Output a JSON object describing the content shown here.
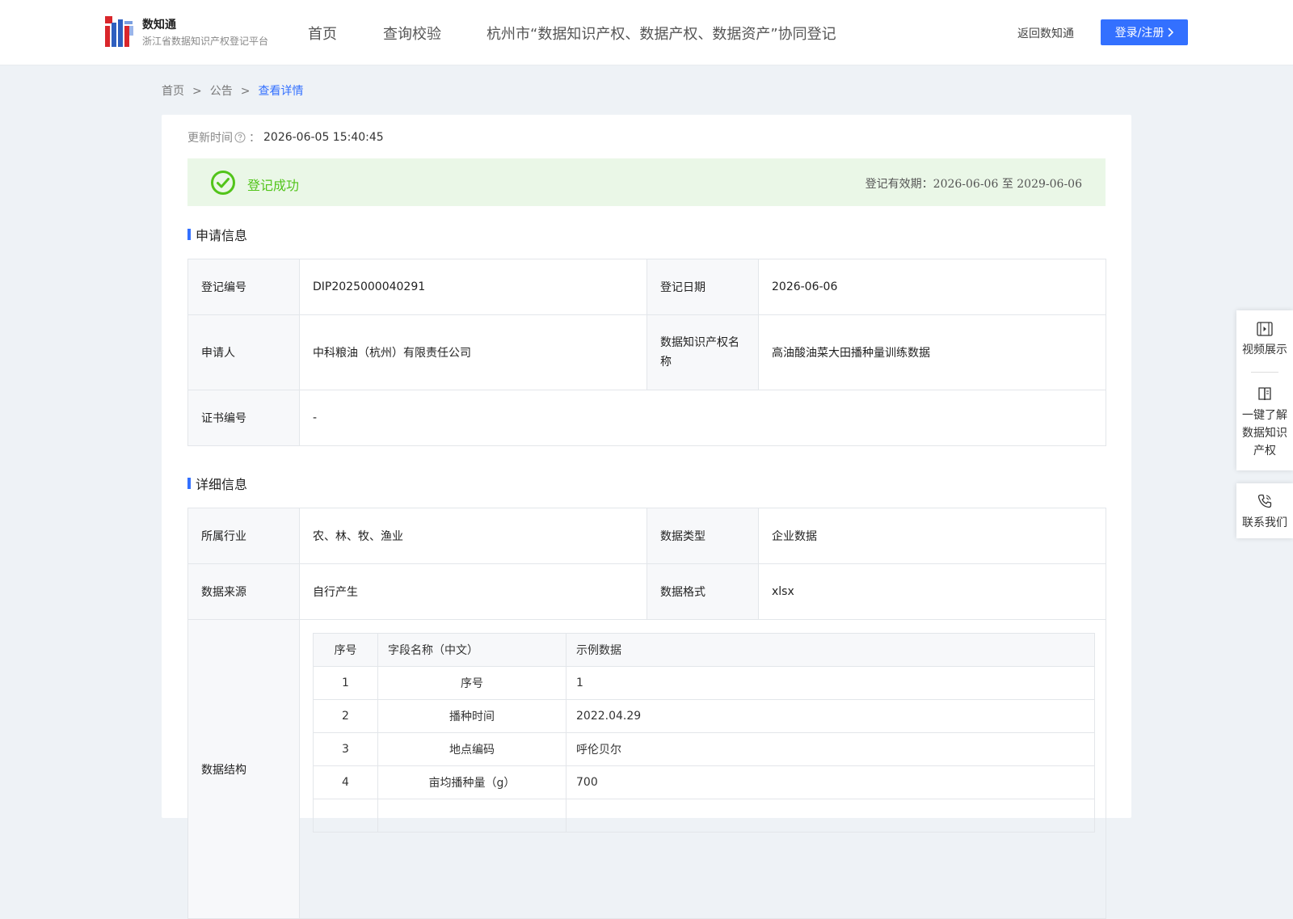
{
  "header": {
    "brand_name": "数知通",
    "brand_sub": "浙江省数据知识产权登记平台",
    "nav": [
      "首页",
      "查询校验",
      "杭州市“数据知识产权、数据产权、数据资产”协同登记"
    ],
    "back_link": "返回数知通",
    "login_label": "登录/注册"
  },
  "breadcrumb": [
    "首页",
    "公告",
    "查看详情"
  ],
  "update": {
    "label": "更新时间",
    "colon": "：",
    "time": "2026-06-05 15:40:45"
  },
  "status": {
    "text": "登记成功",
    "validity": "登记有效期：2026-06-06 至 2029-06-06",
    "color": "#52c41a"
  },
  "sections": {
    "apply": "申请信息",
    "detail": "详细信息"
  },
  "apply_info": {
    "reg_no_label": "登记编号",
    "reg_no": "DIP2025000040291",
    "reg_date_label": "登记日期",
    "reg_date": "2026-06-06",
    "applicant_label": "申请人",
    "applicant": "中科粮油（杭州）有限责任公司",
    "ip_name_label": "数据知识产权名称",
    "ip_name": "高油酸油菜大田播种量训练数据",
    "cert_no_label": "证书编号",
    "cert_no": "-"
  },
  "detail_info": {
    "industry_label": "所属行业",
    "industry": "农、林、牧、渔业",
    "data_type_label": "数据类型",
    "data_type": "企业数据",
    "source_label": "数据来源",
    "source": "自行产生",
    "format_label": "数据格式",
    "format": "xlsx",
    "structure_label": "数据结构"
  },
  "structure_table": {
    "headers": [
      "序号",
      "字段名称（中文）",
      "示例数据"
    ],
    "rows": [
      {
        "no": "1",
        "field": "序号",
        "example": "1"
      },
      {
        "no": "2",
        "field": "播种时间",
        "example": "2022.04.29"
      },
      {
        "no": "3",
        "field": "地点编码",
        "example": "呼伦贝尔"
      },
      {
        "no": "4",
        "field": "亩均播种量（g）",
        "example": "700"
      }
    ]
  },
  "float_panel": {
    "video": "视频展示",
    "learn": "一键了解数据知识产权",
    "contact": "联系我们"
  },
  "colors": {
    "accent": "#3370ff",
    "success": "#52c41a",
    "success_bg": "#eaf7e7"
  }
}
